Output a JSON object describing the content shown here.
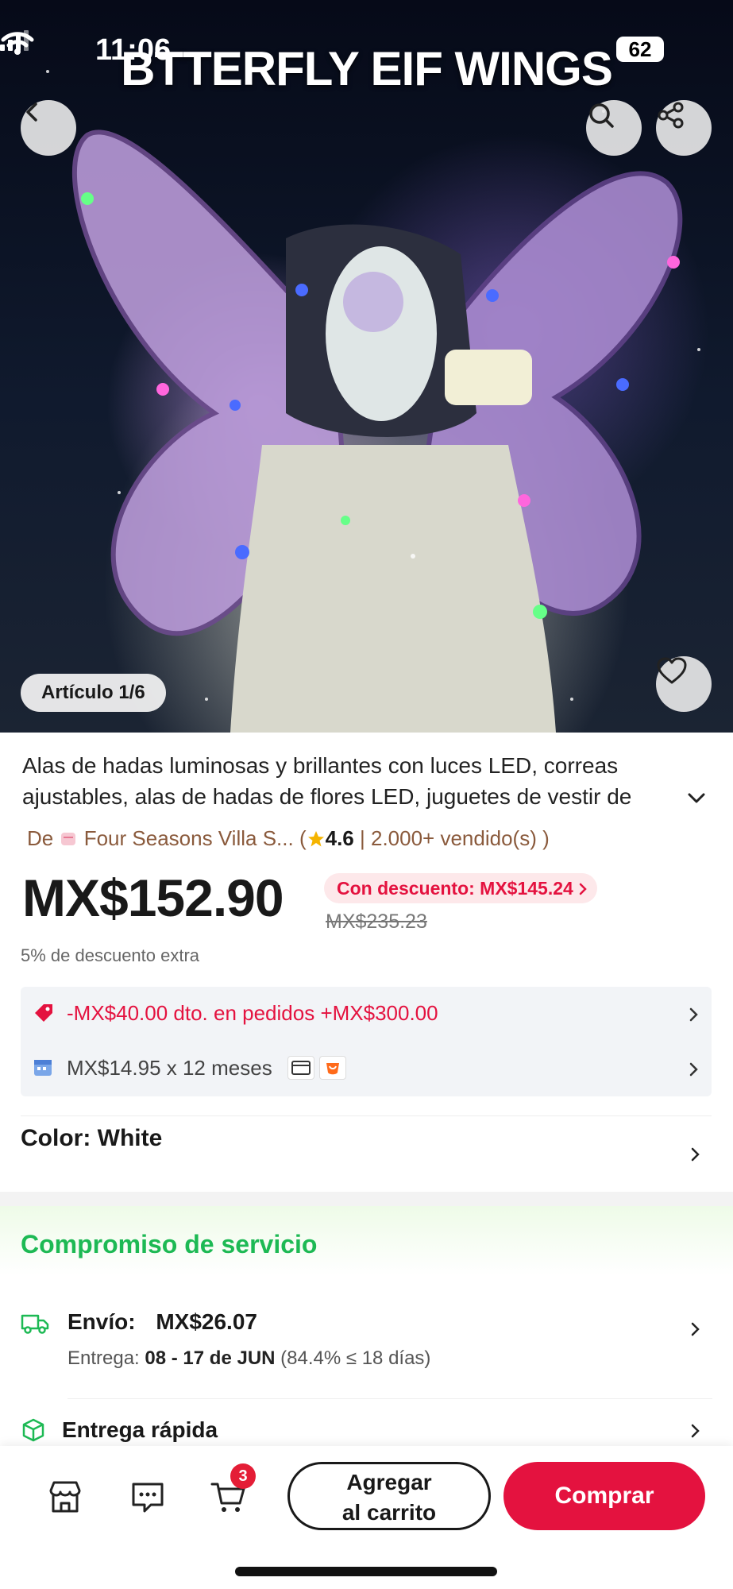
{
  "status_bar": {
    "time": "11:06",
    "battery": "62"
  },
  "hero": {
    "overlay_title": "BTTERFLY EIF WINGS",
    "counter": "Artículo 1/6"
  },
  "product": {
    "title": "Alas de hadas luminosas y brillantes con luces LED, correas ajustables, alas de hadas de flores LED, juguetes de vestir de",
    "store_prefix": "De",
    "store_name": "Four Seasons Villa S...",
    "rating_open": "(",
    "rating": "4.6",
    "sold": "| 2.000+ vendido(s) )",
    "price": "MX$152.90",
    "discount_badge": "Con descuento: MX$145.24",
    "old_price": "MX$235.23",
    "extra_discount": "5% de descuento extra"
  },
  "promos": {
    "coupon": "-MX$40.00 dto. en pedidos +MX$300.00",
    "installments": "MX$14.95 x 12 meses"
  },
  "variant": {
    "color_label": "Color: White"
  },
  "service": {
    "title": "Compromiso de servicio",
    "shipping_label": "Envío:",
    "shipping_price": "MX$26.07",
    "delivery_prefix": "Entrega:",
    "delivery_dates": "08 - 17 de JUN",
    "delivery_note": "(84.4% ≤ 18 días)",
    "fast_delivery": "Entrega rápida"
  },
  "bottom_bar": {
    "cart_count": "3",
    "add_to_cart_line1": "Agregar",
    "add_to_cart_line2": "al carrito",
    "buy": "Comprar"
  },
  "colors": {
    "accent": "#e4123f",
    "service_green": "#1db954"
  }
}
